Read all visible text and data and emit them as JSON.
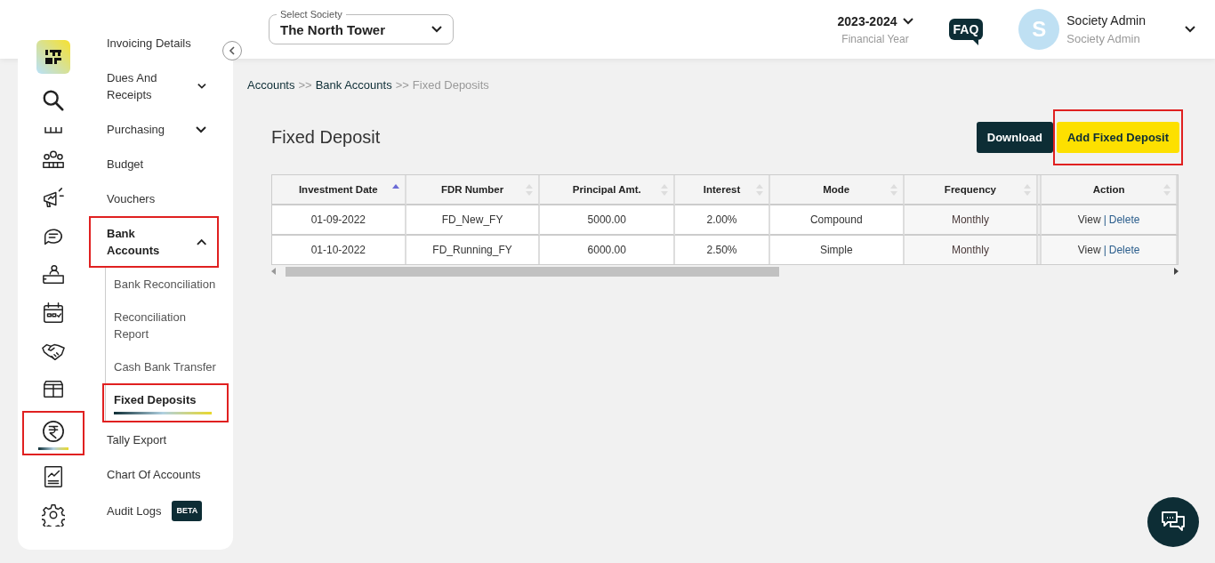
{
  "header": {
    "society_select": {
      "label": "Select Society",
      "value": "The North Tower"
    },
    "financial_year": {
      "value": "2023-2024",
      "caption": "Financial Year"
    },
    "faq": "FAQ",
    "user": {
      "initial": "S",
      "name": "Society Admin",
      "role": "Society Admin"
    }
  },
  "rail_icons": [
    {
      "selected": false,
      "highlighted": false
    },
    {
      "selected": false,
      "highlighted": false
    },
    {
      "selected": false,
      "highlighted": false
    },
    {
      "selected": false,
      "highlighted": false
    },
    {
      "selected": false,
      "highlighted": false
    },
    {
      "selected": false,
      "highlighted": false
    },
    {
      "selected": false,
      "highlighted": false
    },
    {
      "selected": false,
      "highlighted": false
    },
    {
      "selected": false,
      "highlighted": false
    },
    {
      "selected": false,
      "highlighted": false
    },
    {
      "selected": true,
      "highlighted": true
    },
    {
      "selected": false,
      "highlighted": false
    },
    {
      "selected": false,
      "highlighted": false
    }
  ],
  "menu": [
    {
      "label": "Invoicing Details",
      "selected": false,
      "highlighted": false
    },
    {
      "label": "Dues And Receipts",
      "selected": false,
      "highlighted": false,
      "expanded": false
    },
    {
      "label": "Purchasing",
      "selected": false,
      "highlighted": false,
      "expanded": false
    },
    {
      "label": "Budget",
      "selected": false,
      "highlighted": false
    },
    {
      "label": "Vouchers",
      "selected": false,
      "highlighted": false
    },
    {
      "label": "Bank Accounts",
      "selected": false,
      "highlighted": true,
      "expanded": true,
      "children": [
        {
          "label": "Bank Reconciliation",
          "selected": false,
          "highlighted": false
        },
        {
          "label": "Reconciliation Report",
          "selected": false,
          "highlighted": false
        },
        {
          "label": "Cash Bank Transfer",
          "selected": false,
          "highlighted": false
        },
        {
          "label": "Fixed Deposits",
          "selected": true,
          "highlighted": true
        }
      ]
    },
    {
      "label": "Tally Export",
      "selected": false,
      "highlighted": false
    },
    {
      "label": "Chart Of Accounts",
      "selected": false,
      "highlighted": false
    },
    {
      "label": "Audit Logs",
      "selected": false,
      "highlighted": false,
      "badge": "BETA"
    }
  ],
  "breadcrumb": [
    {
      "label": "Accounts",
      "current": false
    },
    {
      "label": "Bank Accounts",
      "current": false
    },
    {
      "label": "Fixed Deposits",
      "current": true
    }
  ],
  "breadcrumb_separator": ">>",
  "page_title": "Fixed Deposit",
  "actions": [
    {
      "label": "Download",
      "kind": "dark",
      "highlighted": false
    },
    {
      "label": "Add Fixed Deposit",
      "kind": "primary",
      "highlighted": true
    }
  ],
  "table": {
    "columns": [
      {
        "label": "Investment Date",
        "sorted": true
      },
      {
        "label": "FDR Number",
        "sorted": false
      },
      {
        "label": "Principal Amt.",
        "sorted": false
      },
      {
        "label": "Interest",
        "sorted": false
      },
      {
        "label": "Mode",
        "sorted": false
      },
      {
        "label": "Frequency",
        "sorted": false
      },
      {
        "label": "Action",
        "sorted": false
      }
    ],
    "rows": [
      {
        "cells": [
          "01-09-2022",
          "FD_New_FY",
          "5000.00",
          "2.00%",
          "Compound",
          "Monthly"
        ],
        "actions": [
          "View",
          "Delete"
        ]
      },
      {
        "cells": [
          "01-10-2022",
          "FD_Running_FY",
          "6000.00",
          "2.50%",
          "Simple",
          "Monthly"
        ],
        "actions": [
          "View",
          "Delete"
        ]
      }
    ],
    "action_separator": "|"
  }
}
